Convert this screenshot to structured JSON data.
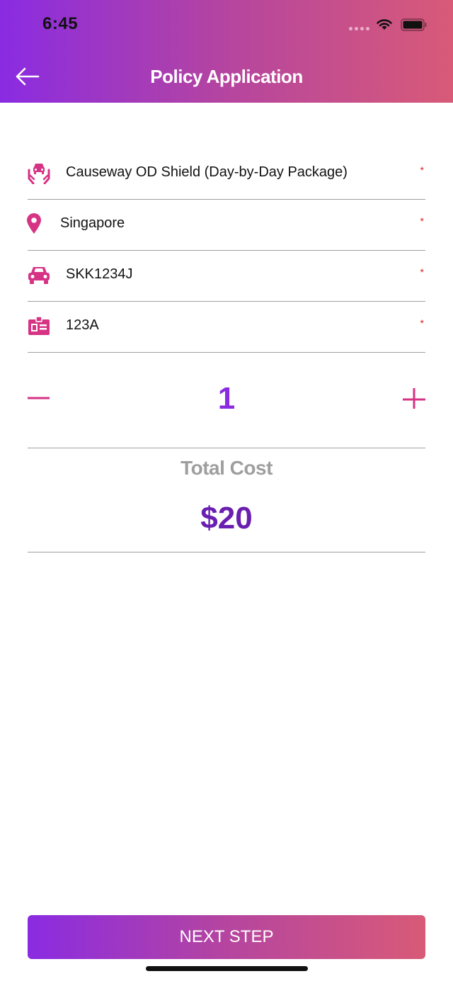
{
  "status_bar": {
    "time": "6:45"
  },
  "header": {
    "title": "Policy Application",
    "back_icon": "arrow-left-icon"
  },
  "form": {
    "fields": [
      {
        "icon": "car-protection-icon",
        "value": "Causeway OD Shield (Day-by-Day Package)",
        "required": "*"
      },
      {
        "icon": "location-pin-icon",
        "value": "Singapore",
        "required": "*"
      },
      {
        "icon": "car-icon",
        "value": "SKK1234J",
        "required": "*"
      },
      {
        "icon": "id-card-icon",
        "value": "123A",
        "required": "*"
      }
    ]
  },
  "stepper": {
    "quantity": "1",
    "minus_icon": "minus-icon",
    "plus_icon": "plus-icon"
  },
  "total": {
    "label": "Total Cost",
    "value": "$20"
  },
  "footer": {
    "next_label": "NEXT STEP"
  },
  "colors": {
    "accent_start": "#8a2be2",
    "accent_end": "#d85a78",
    "icon_pink": "#d63384",
    "required": "#e02020"
  }
}
